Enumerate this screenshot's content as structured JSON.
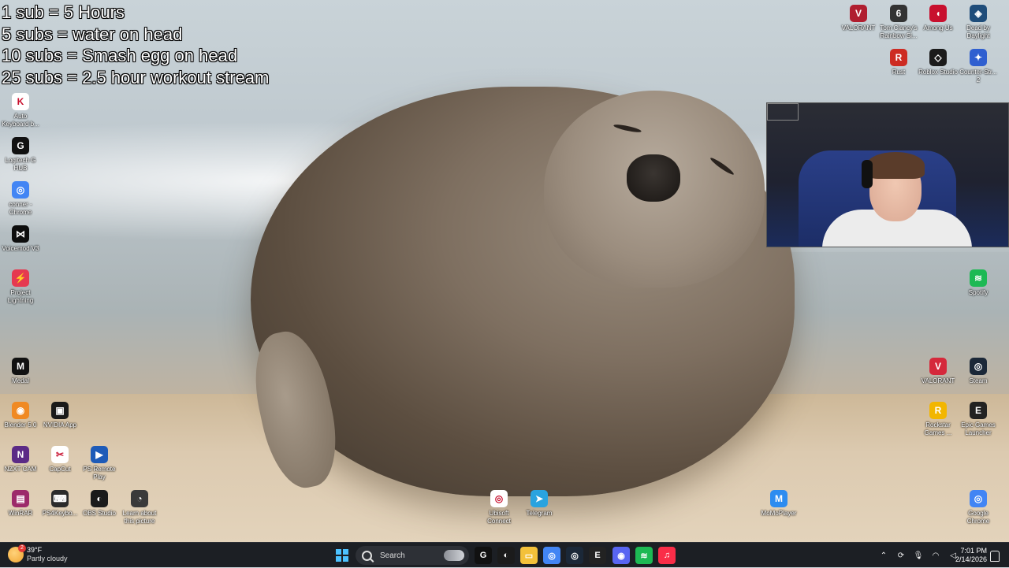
{
  "overlay": {
    "lines": [
      "1 sub = 5 Hours",
      "5 subs = water on head",
      "10 subs = Smash egg on head",
      "25 subs = 2.5 hour workout stream"
    ]
  },
  "desktop_icons_left": [
    {
      "label": "Auto Keyboard b...",
      "icon": "auto-keyboard-icon",
      "color": "#ffffff",
      "glyph": "K"
    },
    {
      "label": "Logitech G HUB",
      "icon": "logitech-icon",
      "color": "#111111",
      "glyph": "G"
    },
    {
      "label": "conner - Chrome",
      "icon": "chrome-icon",
      "color": "#4285f4",
      "glyph": "◎"
    },
    {
      "label": "Voicemod V3",
      "icon": "voicemod-icon",
      "color": "#0d0d0d",
      "glyph": "⋈"
    },
    {
      "label": "Project Lightning",
      "icon": "project-lightning-icon",
      "color": "#e53950",
      "glyph": "⚡"
    },
    {
      "label": "Medal",
      "icon": "medal-icon",
      "color": "#111111",
      "glyph": "M"
    },
    {
      "label": "Blender 5.0",
      "icon": "blender-icon",
      "color": "#f08a24",
      "glyph": "◉"
    },
    {
      "label": "NVIDIA App",
      "icon": "nvidia-icon",
      "color": "#1a1a1a",
      "glyph": "▣"
    },
    {
      "label": "NZXT CAM",
      "icon": "nzxt-icon",
      "color": "#5b2a86",
      "glyph": "N"
    },
    {
      "label": "CapCut",
      "icon": "capcut-icon",
      "color": "#ffffff",
      "glyph": "✂"
    },
    {
      "label": "PS Remote Play",
      "icon": "ps-remote-icon",
      "color": "#1e5bb8",
      "glyph": "▶"
    },
    {
      "label": "WinRAR",
      "icon": "winrar-icon",
      "color": "#9c2a6a",
      "glyph": "▤"
    },
    {
      "label": "PS4Keybo...",
      "icon": "ps4keyboard-icon",
      "color": "#2b2b2b",
      "glyph": "⌨"
    },
    {
      "label": "OBS Studio",
      "icon": "obs-icon",
      "color": "#1b1b1b",
      "glyph": "◐"
    },
    {
      "label": "Learn about this picture",
      "icon": "learn-picture-icon",
      "color": "#3a3a3a",
      "glyph": "◔"
    }
  ],
  "desktop_icons_right": [
    {
      "label": "VALORANT",
      "icon": "valorant-icon",
      "color": "#b01e2f",
      "glyph": "V"
    },
    {
      "label": "Tom Clancy's Rainbow Si...",
      "icon": "rainbow-six-icon",
      "color": "#333333",
      "glyph": "6"
    },
    {
      "label": "Among Us",
      "icon": "among-us-icon",
      "color": "#c8102e",
      "glyph": "◖"
    },
    {
      "label": "Dead by Daylight",
      "icon": "dead-by-daylight-icon",
      "color": "#1f4d7a",
      "glyph": "◈"
    },
    {
      "label": "Rust",
      "icon": "rust-icon",
      "color": "#cd2b22",
      "glyph": "R"
    },
    {
      "label": "Roblox Studio",
      "icon": "roblox-studio-icon",
      "color": "#1b1b1b",
      "glyph": "◇"
    },
    {
      "label": "Counter-Str... 2",
      "icon": "counter-strike-icon",
      "color": "#2f5fd0",
      "glyph": "✦"
    },
    {
      "label": "Spotify",
      "icon": "spotify-icon",
      "color": "#1db954",
      "glyph": "≋"
    },
    {
      "label": "VALORANT",
      "icon": "valorant-icon",
      "color": "#d5293b",
      "glyph": "V"
    },
    {
      "label": "Steam",
      "icon": "steam-icon",
      "color": "#1b2838",
      "glyph": "◎"
    },
    {
      "label": "Rockstar Games ...",
      "icon": "rockstar-icon",
      "color": "#f2b600",
      "glyph": "R"
    },
    {
      "label": "Epic Games Launcher",
      "icon": "epic-games-icon",
      "color": "#222222",
      "glyph": "E"
    },
    {
      "label": "Google Chrome",
      "icon": "chrome-icon",
      "color": "#4285f4",
      "glyph": "◎"
    }
  ],
  "desktop_icons_center": [
    {
      "label": "Ubisoft Connect",
      "icon": "ubisoft-icon",
      "color": "#ffffff",
      "glyph": "◎"
    },
    {
      "label": "Telegram",
      "icon": "telegram-icon",
      "color": "#2aa3df",
      "glyph": "➤"
    },
    {
      "label": "MoMoPlayer",
      "icon": "momoplayer-icon",
      "color": "#2d8cf0",
      "glyph": "M"
    }
  ],
  "taskbar": {
    "weather_temp": "39°F",
    "weather_desc": "Partly cloudy",
    "weather_badge": "2",
    "search_placeholder": "Search",
    "apps": [
      {
        "name": "logitech-ghub-taskbar-icon",
        "glyph": "G",
        "color": "#111111"
      },
      {
        "name": "obs-taskbar-icon",
        "glyph": "◐",
        "color": "#1b1b1b"
      },
      {
        "name": "file-explorer-taskbar-icon",
        "glyph": "▭",
        "color": "#f3c13a"
      },
      {
        "name": "chrome-taskbar-icon",
        "glyph": "◎",
        "color": "#4285f4"
      },
      {
        "name": "steam-taskbar-icon",
        "glyph": "◎",
        "color": "#1b2838"
      },
      {
        "name": "epic-taskbar-icon",
        "glyph": "E",
        "color": "#222222"
      },
      {
        "name": "discord-taskbar-icon",
        "glyph": "◉",
        "color": "#5865f2"
      },
      {
        "name": "spotify-taskbar-icon",
        "glyph": "≋",
        "color": "#1db954"
      },
      {
        "name": "music-taskbar-icon",
        "glyph": "♫",
        "color": "#fa2d48"
      }
    ],
    "time": "7:01 PM",
    "date": "2/14/2026"
  }
}
